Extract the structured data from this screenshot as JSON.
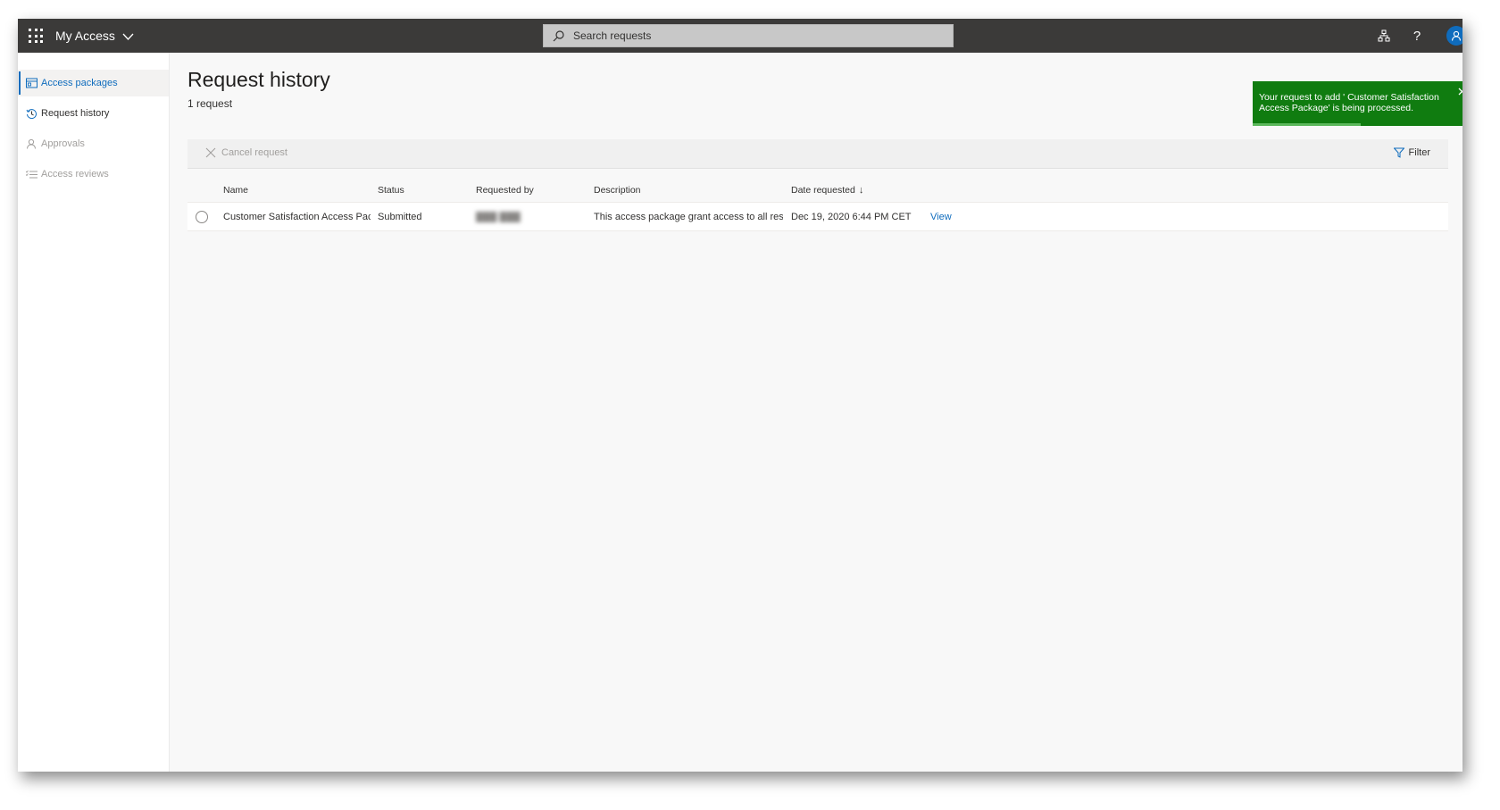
{
  "header": {
    "app_title": "My Access",
    "search_placeholder": "Search requests",
    "icons": [
      "waffle-icon",
      "chevron-down-icon",
      "search-icon",
      "org-chart-icon",
      "help-icon",
      "user-avatar-icon"
    ]
  },
  "sidebar": {
    "items": [
      {
        "label": "Access packages",
        "icon": "package-icon",
        "state": "active"
      },
      {
        "label": "Request history",
        "icon": "history-icon",
        "state": "normal"
      },
      {
        "label": "Approvals",
        "icon": "person-icon",
        "state": "disabled"
      },
      {
        "label": "Access reviews",
        "icon": "checklist-icon",
        "state": "disabled"
      }
    ]
  },
  "main": {
    "title": "Request history",
    "subtitle": "1 request",
    "commandbar": {
      "cancel_label": "Cancel request",
      "filter_label": "Filter"
    },
    "table": {
      "columns": [
        "Name",
        "Status",
        "Requested by",
        "Description",
        "Date requested"
      ],
      "sort_indicator": "↓",
      "rows": [
        {
          "name": "Customer Satisfaction Access Pack",
          "status": "Submitted",
          "requested_by": "███ ███",
          "description": "This access package grant access to all reso",
          "date": "Dec 19, 2020 6:44 PM CET",
          "action": "View"
        }
      ]
    }
  },
  "toast": {
    "message": "Your request to add ' Customer Satisfaction Access Package' is being processed.",
    "progress": 0.49,
    "color": "#107c10"
  },
  "colors": {
    "accent": "#0f6cbd",
    "topbar": "#3b3a39",
    "success": "#107c10"
  }
}
